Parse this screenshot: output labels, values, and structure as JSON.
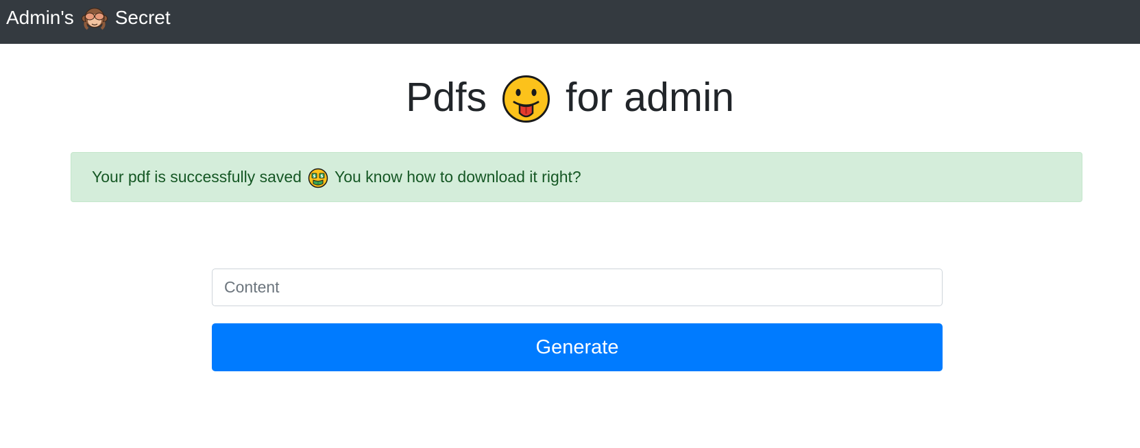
{
  "navbar": {
    "brand_prefix": "Admin's",
    "brand_suffix": "Secret",
    "brand_icon": "see-no-evil-monkey-icon"
  },
  "header": {
    "title_prefix": "Pdfs",
    "title_suffix": "for admin",
    "title_icon": "face-with-tongue-icon"
  },
  "alert": {
    "message_prefix": "Your pdf is successfully saved",
    "message_suffix": "You know how to download it right?",
    "icon": "money-mouth-face-icon",
    "type": "success",
    "colors": {
      "background": "#d4edda",
      "border": "#c3e6cb",
      "text": "#155724"
    }
  },
  "form": {
    "content_placeholder": "Content",
    "content_value": "",
    "generate_label": "Generate",
    "button_color": "#007bff"
  },
  "colors": {
    "navbar_bg": "#343a40",
    "text": "#212529"
  }
}
